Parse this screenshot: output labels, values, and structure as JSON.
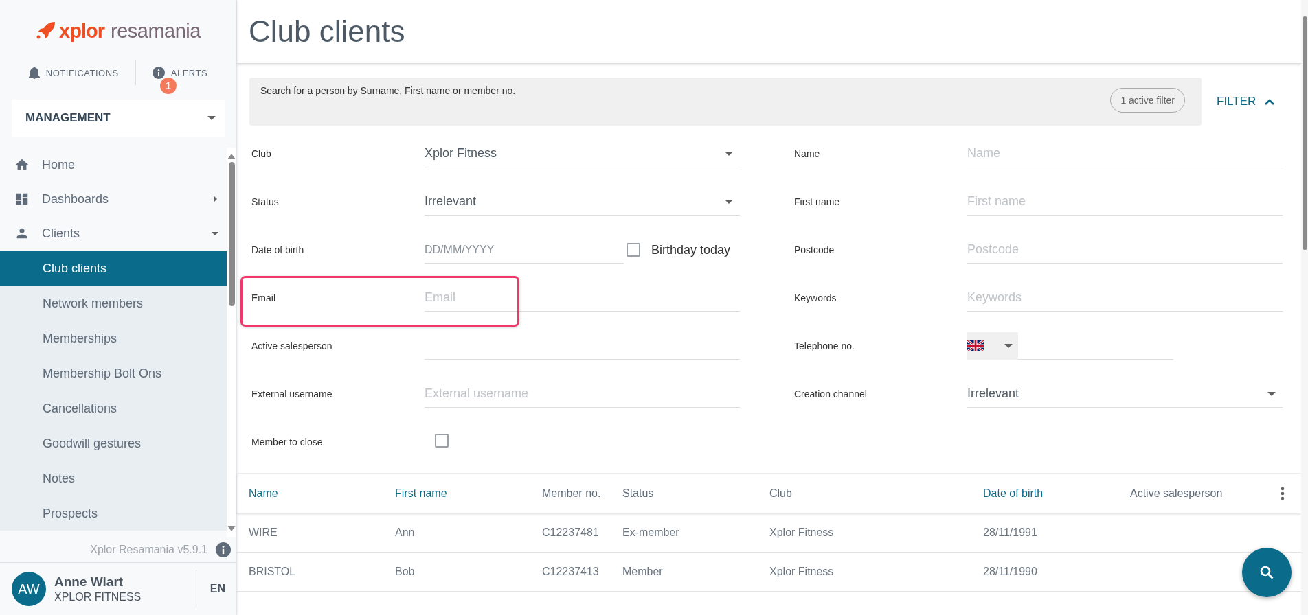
{
  "sidebar": {
    "logo": {
      "brand": "xplor",
      "product": "resamania"
    },
    "notifications": {
      "label": "NOTIFICATIONS"
    },
    "alerts": {
      "label": "ALERTS",
      "badge": "1"
    },
    "role_select": {
      "value": "MANAGEMENT"
    },
    "menu": [
      {
        "label": "Home",
        "kind": "link",
        "selected": false
      },
      {
        "label": "Dashboards",
        "kind": "group",
        "expanded": false,
        "selected": false
      },
      {
        "label": "Clients",
        "kind": "group",
        "expanded": true,
        "selected": false,
        "children": [
          {
            "label": "Club clients",
            "selected": true
          },
          {
            "label": "Network members",
            "selected": false
          },
          {
            "label": "Memberships",
            "selected": false
          },
          {
            "label": "Membership Bolt Ons",
            "selected": false
          },
          {
            "label": "Cancellations",
            "selected": false
          },
          {
            "label": "Goodwill gestures",
            "selected": false
          },
          {
            "label": "Notes",
            "selected": false
          },
          {
            "label": "Prospects",
            "selected": false
          }
        ]
      }
    ],
    "version": "Xplor Resamania v5.9.1",
    "user": {
      "initials": "AW",
      "name": "Anne Wiart",
      "club": "XPLOR FITNESS",
      "language": "EN"
    }
  },
  "page": {
    "title": "Club clients",
    "search": {
      "placeholder": "Search for a person by Surname, First name or member no.",
      "active_filters": "1 active filter"
    },
    "filter_toggle": {
      "label": "FILTER",
      "expanded": true
    },
    "filters_left": [
      {
        "label": "Club",
        "kind": "select",
        "value": "Xplor Fitness"
      },
      {
        "label": "Status",
        "kind": "select",
        "value": "Irrelevant"
      },
      {
        "label": "Date of birth",
        "kind": "date",
        "placeholder": "DD/MM/YYYY",
        "option": {
          "label": "Birthday today",
          "checked": false
        }
      },
      {
        "label": "Email",
        "kind": "text",
        "placeholder": "Email",
        "highlighted": true
      },
      {
        "label": "Active salesperson",
        "kind": "text"
      },
      {
        "label": "External username",
        "kind": "text",
        "placeholder": "External username"
      },
      {
        "label": "Member to close",
        "kind": "checkbox",
        "checked": false
      }
    ],
    "filters_right": [
      {
        "label": "Name",
        "kind": "text",
        "placeholder": "Name"
      },
      {
        "label": "First name",
        "kind": "text",
        "placeholder": "First name"
      },
      {
        "label": "Postcode",
        "kind": "text",
        "placeholder": "Postcode"
      },
      {
        "label": "Keywords",
        "kind": "text",
        "placeholder": "Keywords"
      },
      {
        "label": "Telephone no.",
        "kind": "phone"
      },
      {
        "label": "Creation channel",
        "kind": "select",
        "value": "Irrelevant"
      }
    ],
    "table": {
      "columns": [
        {
          "label": "Name",
          "sortable": true
        },
        {
          "label": "First name",
          "sortable": true
        },
        {
          "label": "Member no.",
          "sortable": false
        },
        {
          "label": "Status",
          "sortable": false
        },
        {
          "label": "Club",
          "sortable": false
        },
        {
          "label": "Date of birth",
          "sortable": true
        },
        {
          "label": "Active salesperson",
          "sortable": false
        }
      ],
      "rows": [
        [
          "WIRE",
          "Ann",
          "C12237481",
          "Ex-member",
          "Xplor Fitness",
          "28/11/1991",
          ""
        ],
        [
          "BRISTOL",
          "Bob",
          "C12237413",
          "Member",
          "Xplor Fitness",
          "28/11/1990",
          ""
        ]
      ]
    }
  }
}
